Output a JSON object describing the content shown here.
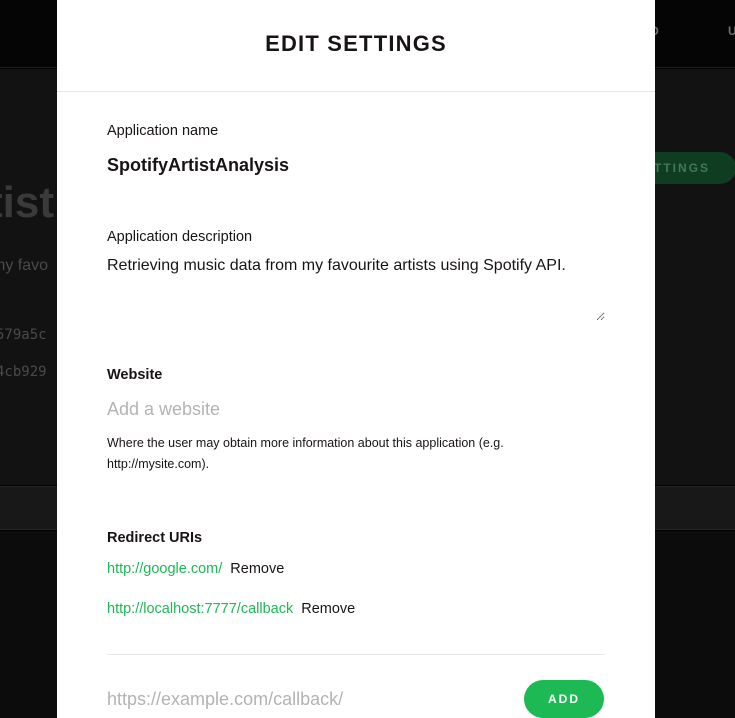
{
  "background": {
    "nav_dashboard": "RD",
    "nav_user": "U",
    "edit_settings_button": "TTINGS",
    "title_fragment": "tist",
    "description_fragment": "my favo",
    "client_id_fragment": "579a5c",
    "client_secret_fragment": "4cb929"
  },
  "modal": {
    "title": "EDIT SETTINGS",
    "app_name": {
      "label": "Application name",
      "value": "SpotifyArtistAnalysis"
    },
    "app_description": {
      "label": "Application description",
      "value": "Retrieving music data from my favourite artists using Spotify API."
    },
    "website": {
      "label": "Website",
      "placeholder": "Add a website",
      "help": "Where the user may obtain more information about this application (e.g. http://mysite.com)."
    },
    "redirect_uris": {
      "label": "Redirect URIs",
      "items": [
        {
          "uri": "http://google.com/",
          "remove_label": "Remove"
        },
        {
          "uri": "http://localhost:7777/callback",
          "remove_label": "Remove"
        }
      ],
      "add_placeholder": "https://example.com/callback/",
      "add_button_label": "ADD"
    }
  },
  "colors": {
    "accent": "#1db954",
    "text": "#191414",
    "placeholder": "#b3b3b3",
    "overlay_bg": "#000000"
  }
}
